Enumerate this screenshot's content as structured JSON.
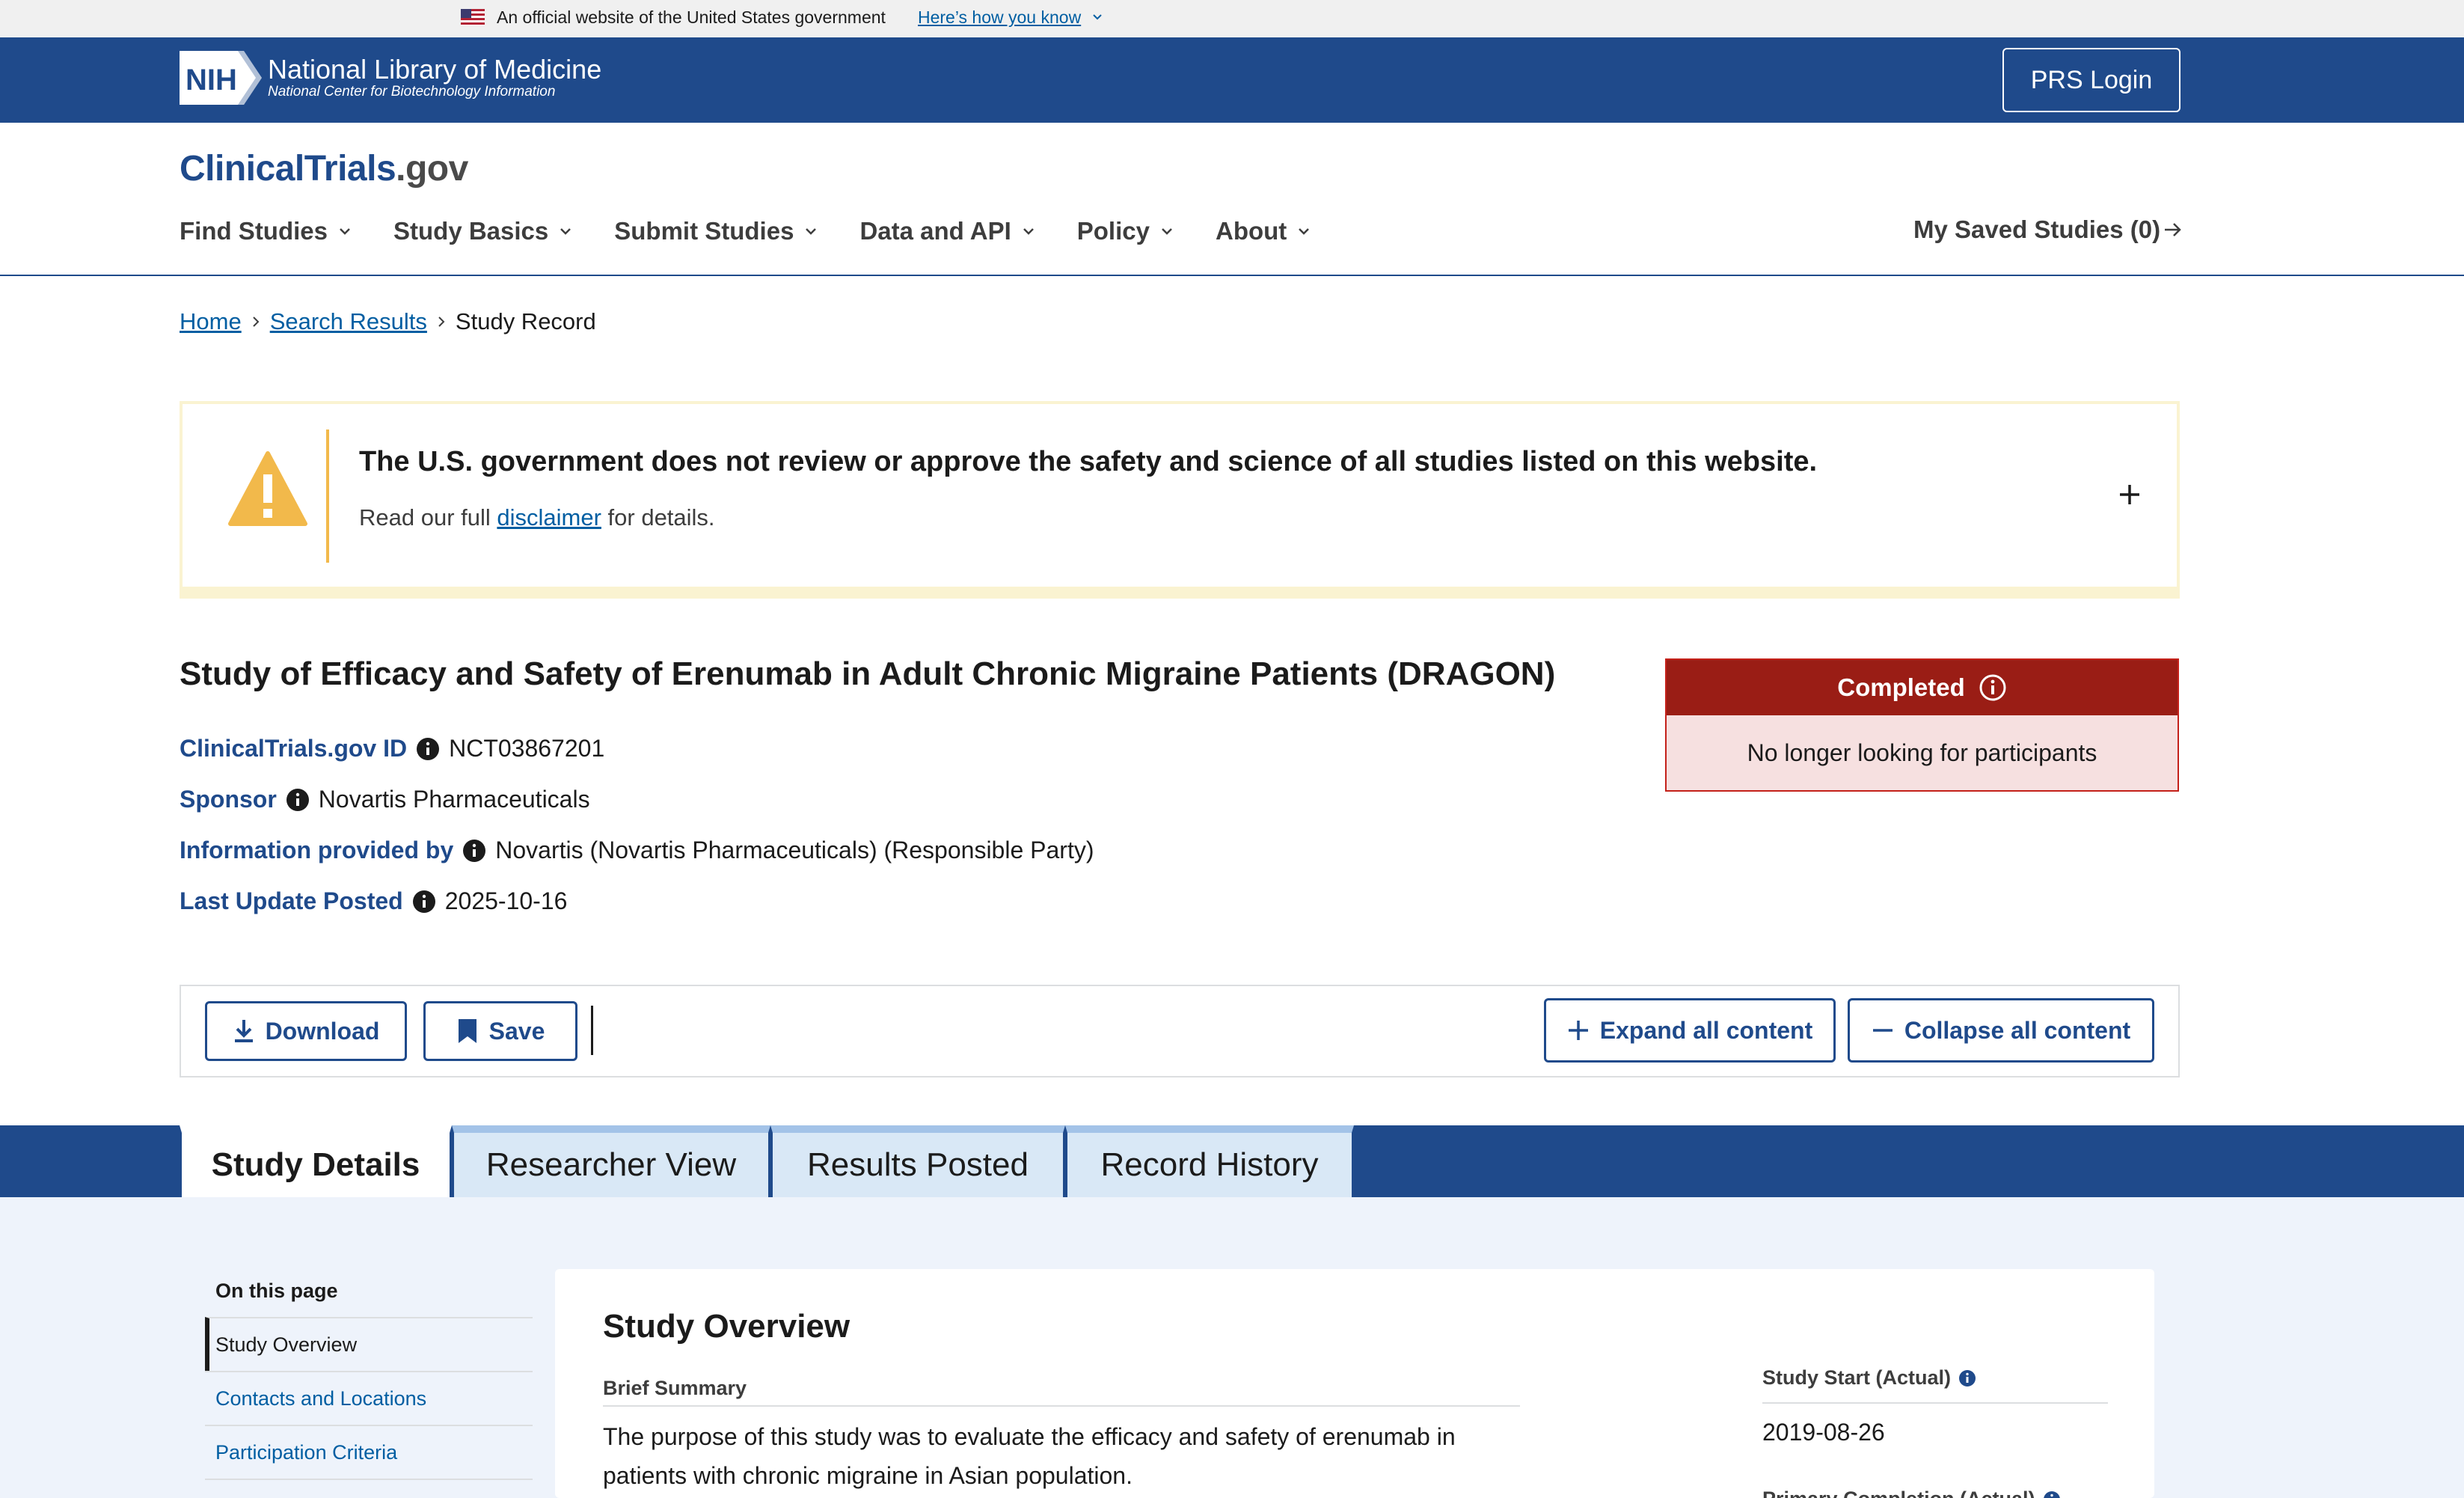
{
  "gov_banner": {
    "official_text": "An official website of the United States government",
    "how_you_know": "Here’s how you know"
  },
  "nih_header": {
    "logo_text": "NIH",
    "title": "National Library of Medicine",
    "subtitle": "National Center for Biotechnology Information",
    "prs_login": "PRS Login"
  },
  "site": {
    "logo_main": "ClinicalTrials",
    "logo_suffix": ".gov"
  },
  "nav": {
    "items": [
      {
        "label": "Find Studies"
      },
      {
        "label": "Study Basics"
      },
      {
        "label": "Submit Studies"
      },
      {
        "label": "Data and API"
      },
      {
        "label": "Policy"
      },
      {
        "label": "About"
      }
    ],
    "saved_studies": "My Saved Studies (0)"
  },
  "breadcrumb": {
    "home": "Home",
    "search_results": "Search Results",
    "current": "Study Record"
  },
  "disclaimer": {
    "title": "The U.S. government does not review or approve the safety and science of all studies listed on this website.",
    "text_before": "Read our full ",
    "link": "disclaimer",
    "text_after": " for details."
  },
  "study": {
    "title": "Study of Efficacy and Safety of Erenumab in Adult Chronic Migraine Patients (DRAGON)",
    "facts": [
      {
        "label": "ClinicalTrials.gov ID",
        "value": "NCT03867201"
      },
      {
        "label": "Sponsor",
        "value": "Novartis Pharmaceuticals"
      },
      {
        "label": "Information provided by",
        "value": "Novartis (Novartis Pharmaceuticals) (Responsible Party)"
      },
      {
        "label": "Last Update Posted",
        "value": "2025-10-16"
      }
    ],
    "status": {
      "label": "Completed",
      "description": "No longer looking for participants"
    }
  },
  "toolbar": {
    "download": "Download",
    "save": "Save",
    "expand_all": "Expand all content",
    "collapse_all": "Collapse all content"
  },
  "tabs": [
    {
      "label": "Study Details",
      "active": true
    },
    {
      "label": "Researcher View",
      "active": false
    },
    {
      "label": "Results Posted",
      "active": false
    },
    {
      "label": "Record History",
      "active": false
    }
  ],
  "on_this_page": {
    "title": "On this page",
    "items": [
      {
        "label": "Study Overview",
        "active": true
      },
      {
        "label": "Contacts and Locations",
        "active": false
      },
      {
        "label": "Participation Criteria",
        "active": false
      }
    ]
  },
  "overview": {
    "title": "Study Overview",
    "brief_summary_label": "Brief Summary",
    "brief_summary": "The purpose of this study was to evaluate the efficacy and safety of erenumab in patients with chronic migraine in Asian population.",
    "study_start_label": "Study Start (Actual)",
    "study_start_value": "2019-08-26",
    "next_label": "Primary Completion (Actual)"
  },
  "colors": {
    "nih_blue": "#1f4a8b",
    "link_blue": "#005ea2",
    "status_red": "#9a1d15",
    "warning_yellow": "#f2b94b"
  }
}
